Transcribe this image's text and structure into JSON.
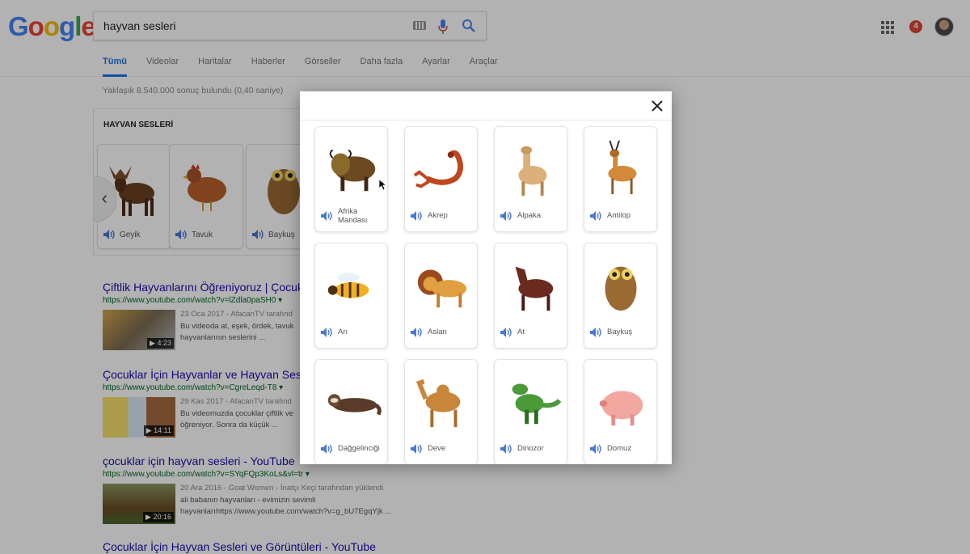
{
  "header": {
    "logo_letters": [
      {
        "ch": "G",
        "color": "#4285f4"
      },
      {
        "ch": "o",
        "color": "#ea4335"
      },
      {
        "ch": "o",
        "color": "#fbbc05"
      },
      {
        "ch": "g",
        "color": "#4285f4"
      },
      {
        "ch": "l",
        "color": "#34a853"
      },
      {
        "ch": "e",
        "color": "#ea4335"
      }
    ],
    "search_value": "hayvan sesleri",
    "notification_count": "4",
    "accent_color": "#1a73e8"
  },
  "tabs": [
    "Tümü",
    "Videolar",
    "Haritalar",
    "Haberler",
    "Görseller",
    "Daha fazla",
    "Ayarlar",
    "Araçlar"
  ],
  "stats": "Yaklaşık 8.540.000 sonuç bulundu (0,40 saniye)",
  "card": {
    "title": "HAYVAN SESLERİ",
    "items": [
      {
        "label": "Geyik",
        "icon": "moose-icon"
      },
      {
        "label": "Tavuk",
        "icon": "chicken-icon"
      },
      {
        "label": "Baykuş",
        "icon": "owl-icon"
      }
    ]
  },
  "results": [
    {
      "title": "Çiftlik Hayvanlarını Öğreniyoruz | Çocuk",
      "url": "https://www.youtube.com/watch?v=lZdla0paSH0",
      "meta": "23 Oca 2017 - AfacanTV tarafınd",
      "snippet": "Bu videoda at, eşek, ördek, tavuk hayvanlarının seslerini ...",
      "duration": "▶ 4:23"
    },
    {
      "title": "Çocuklar İçin Hayvanlar ve Hayvan Ses",
      "url": "https://www.youtube.com/watch?v=CgreLeqd-T8",
      "meta": "29 Kas 2017 - AfacanTV tarafınd",
      "snippet": "Bu videomuzda çocuklar çiftlik ve öğreniyor. Sonra da küçük ...",
      "duration": "▶ 14:11"
    },
    {
      "title": "çocuklar için hayvan sesleri - YouTube",
      "url": "https://www.youtube.com/watch?v=SYqFQp3KoLs&vl=tr",
      "meta": "20 Ara 2016 - Goat Women - İnatçı Keçi tarafından yüklendi",
      "snippet": "ali babanın hayvanları - evimizin sevimli hayvanlarıhttps://www.youtube.com/watch?v=g_bU7EgqYjk ...",
      "duration": "▶ 20:16"
    },
    {
      "title": "Çocuklar İçin Hayvan Sesleri ve Görüntüleri - YouTube",
      "url": "",
      "meta": "",
      "snippet": "",
      "duration": ""
    }
  ],
  "modal": {
    "animals": [
      {
        "label": "Afrika Mandası",
        "icon": "buffalo-icon"
      },
      {
        "label": "Akrep",
        "icon": "scorpion-icon"
      },
      {
        "label": "Alpaka",
        "icon": "alpaca-icon"
      },
      {
        "label": "Antilop",
        "icon": "antelope-icon"
      },
      {
        "label": "Arı",
        "icon": "bee-icon"
      },
      {
        "label": "Aslan",
        "icon": "lion-icon"
      },
      {
        "label": "At",
        "icon": "horse-icon"
      },
      {
        "label": "Baykuş",
        "icon": "owl-icon"
      },
      {
        "label": "Dağgelinciği",
        "icon": "ferret-icon"
      },
      {
        "label": "Deve",
        "icon": "camel-icon"
      },
      {
        "label": "Dinozor",
        "icon": "dinosaur-icon"
      },
      {
        "label": "Domuz",
        "icon": "pig-icon"
      }
    ],
    "speaker_color": "#4a78d6"
  }
}
